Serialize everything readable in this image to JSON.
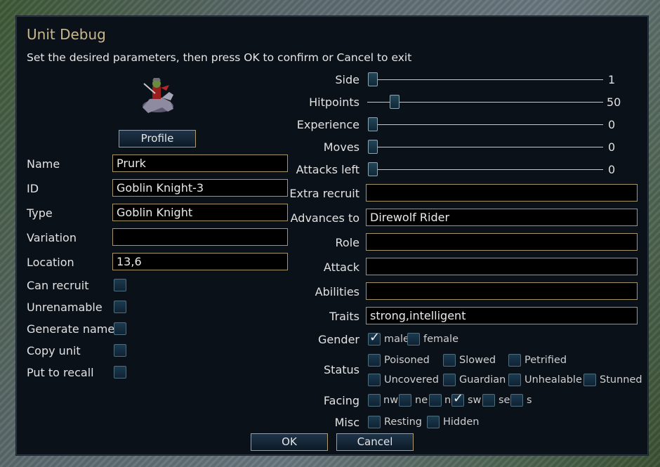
{
  "dialog": {
    "title": "Unit Debug",
    "subtitle": "Set the desired parameters, then press OK to confirm or Cancel to exit",
    "profile_label": "Profile",
    "ok_label": "OK",
    "cancel_label": "Cancel"
  },
  "fields": {
    "name": {
      "label": "Name",
      "value": "Prurk"
    },
    "id": {
      "label": "ID",
      "value": "Goblin Knight-3"
    },
    "type": {
      "label": "Type",
      "value": "Goblin Knight"
    },
    "variation": {
      "label": "Variation",
      "value": ""
    },
    "location": {
      "label": "Location",
      "value": "13,6"
    },
    "extra_recruit": {
      "label": "Extra recruit",
      "value": ""
    },
    "advances_to": {
      "label": "Advances to",
      "value": "Direwolf Rider"
    },
    "role": {
      "label": "Role",
      "value": ""
    },
    "attack": {
      "label": "Attack",
      "value": ""
    },
    "abilities": {
      "label": "Abilities",
      "value": ""
    },
    "traits": {
      "label": "Traits",
      "value": "strong,intelligent"
    }
  },
  "left_toggles": [
    {
      "label": "Can recruit",
      "checked": false
    },
    {
      "label": "Unrenamable",
      "checked": false
    },
    {
      "label": "Generate name",
      "checked": false
    },
    {
      "label": "Copy unit",
      "checked": false
    },
    {
      "label": "Put to recall",
      "checked": false
    }
  ],
  "sliders": [
    {
      "label": "Side",
      "value": "1",
      "level": 0
    },
    {
      "label": "Hitpoints",
      "value": "50",
      "level": 0.11
    },
    {
      "label": "Experience",
      "value": "0",
      "level": 0
    },
    {
      "label": "Moves",
      "value": "0",
      "level": 0
    },
    {
      "label": "Attacks left",
      "value": "0",
      "level": 0
    }
  ],
  "gender": {
    "label": "Gender",
    "options": [
      {
        "label": "male",
        "checked": true
      },
      {
        "label": "female",
        "checked": false
      }
    ]
  },
  "status": {
    "label": "Status",
    "options": [
      {
        "label": "Poisoned",
        "checked": false
      },
      {
        "label": "Slowed",
        "checked": false
      },
      {
        "label": "Petrified",
        "checked": false
      },
      {
        "label": "Uncovered",
        "checked": false
      },
      {
        "label": "Guardian",
        "checked": false
      },
      {
        "label": "Unhealable",
        "checked": false
      },
      {
        "label": "Stunned",
        "checked": false
      }
    ]
  },
  "facing": {
    "label": "Facing",
    "options": [
      {
        "label": "nw",
        "checked": false
      },
      {
        "label": "ne",
        "checked": false
      },
      {
        "label": "n",
        "checked": false
      },
      {
        "label": "sw",
        "checked": true
      },
      {
        "label": "se",
        "checked": false
      },
      {
        "label": "s",
        "checked": false
      }
    ]
  },
  "misc": {
    "label": "Misc",
    "options": [
      {
        "label": "Resting",
        "checked": false
      },
      {
        "label": "Hidden",
        "checked": false
      }
    ]
  },
  "colors": {
    "accent_gold": "#c9b88a",
    "field_border": "#a89565",
    "dialog_bg": "#0b1119"
  },
  "icons": {
    "portrait": "goblin-knight-portrait-icon"
  }
}
